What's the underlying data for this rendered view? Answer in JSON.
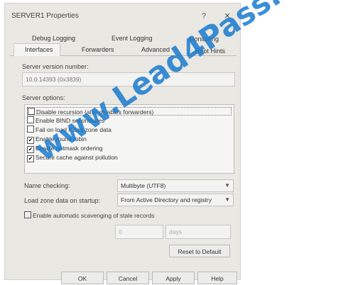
{
  "window": {
    "title": "SERVER1 Properties",
    "help_label": "?",
    "close_label": "✕"
  },
  "tabs": {
    "row1": [
      "Debug Logging",
      "Event Logging",
      "Monitoring"
    ],
    "row2": [
      "Interfaces",
      "Forwarders",
      "Advanced",
      "Root Hints"
    ],
    "active": "Interfaces"
  },
  "server_version": {
    "label": "Server version number:",
    "value": "10.0.14393 (0x3839)"
  },
  "server_options": {
    "label": "Server options:",
    "items": [
      {
        "label": "Disable recursion (also disables forwarders)",
        "checked": false
      },
      {
        "label": "Enable BIND secondaries",
        "checked": false
      },
      {
        "label": "Fail on load if bad zone data",
        "checked": false
      },
      {
        "label": "Enable round robin",
        "checked": true
      },
      {
        "label": "Enable netmask ordering",
        "checked": true
      },
      {
        "label": "Secure cache against pollution",
        "checked": true
      }
    ]
  },
  "name_checking": {
    "label": "Name checking:",
    "value": "Multibyte (UTF8)"
  },
  "load_zone": {
    "label": "Load zone data on startup:",
    "value": "From Active Directory and registry"
  },
  "scavenging": {
    "label": "Enable automatic scavenging of stale records",
    "checked": false,
    "period_value": "0",
    "period_unit": "days"
  },
  "buttons": {
    "reset": "Reset to Default",
    "ok": "OK",
    "cancel": "Cancel",
    "apply": "Apply",
    "help": "Help"
  },
  "watermark": {
    "text": "www.Lead4Pass.com",
    "color": "#1a7ace"
  }
}
